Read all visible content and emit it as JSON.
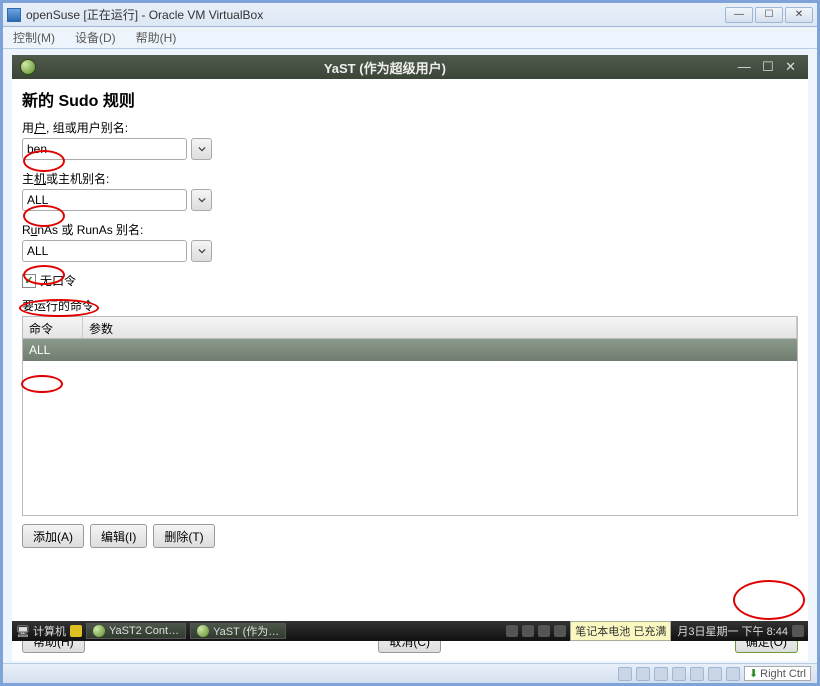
{
  "virtualbox": {
    "title": "openSuse [正在运行] - Oracle VM VirtualBox",
    "menu_control": "控制(M)",
    "menu_device": "设备(D)",
    "menu_help": "帮助(H)",
    "host_key": "Right Ctrl"
  },
  "yast_window": {
    "title": "YaST (作为超级用户)"
  },
  "page": {
    "heading": "新的 Sudo 规则",
    "user_label_pre": "用",
    "user_label_mid": "户",
    "user_label_post": ", 组或用户别名:",
    "user_value": "ben",
    "host_label_pre": "主",
    "host_label_mid": "机",
    "host_label_post": "或主机别名:",
    "host_value": "ALL",
    "runas_label_pre": "R",
    "runas_label_mid": "u",
    "runas_label_post": "nAs 或 RunAs 别名:",
    "runas_value": "ALL",
    "nopass_pre": "无",
    "nopass_mid": "口",
    "nopass_post": "令",
    "nopass_checked": "✓",
    "commands_label": "要运行的命令",
    "col_command": "命令",
    "col_params": "参数",
    "row0_command": "ALL",
    "btn_add": "添加(A)",
    "btn_edit": "编辑(I)",
    "btn_delete": "删除(T)",
    "btn_help": "帮助(H)",
    "btn_cancel": "取消(C)",
    "btn_ok": "确定(O)"
  },
  "taskbar": {
    "computer": "计算机",
    "task1": "YaST2 Cont…",
    "task2": "YaST (作为…",
    "battery": "笔记本电池 已充满",
    "clock": "月3日星期一 下午  8:44"
  }
}
